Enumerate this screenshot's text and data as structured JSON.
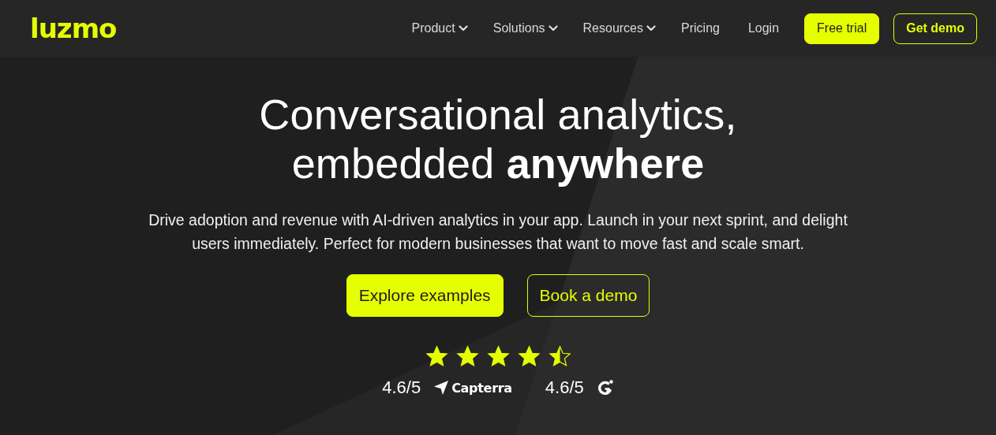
{
  "header": {
    "logo": "luzmo",
    "nav": [
      {
        "label": "Product",
        "dropdown": true
      },
      {
        "label": "Solutions",
        "dropdown": true
      },
      {
        "label": "Resources",
        "dropdown": true
      },
      {
        "label": "Pricing",
        "dropdown": false
      },
      {
        "label": "Login",
        "dropdown": false
      }
    ],
    "buttons": [
      {
        "label": "Free trial",
        "kind": "filled"
      },
      {
        "label": "Get demo",
        "kind": "outline"
      }
    ]
  },
  "hero": {
    "title": "Conversational analytics,\nembedded **anywhere**",
    "subtitle": "Drive adoption and revenue with AI-driven analytics in your app. Launch in your next sprint, and delight users immediately. Perfect for modern businesses that want to move fast and scale smart.",
    "buttons": [
      {
        "label": "Explore examples",
        "kind": "filled"
      },
      {
        "label": "Book a demo",
        "kind": "outline"
      }
    ],
    "stars": 4.5,
    "ratings": [
      {
        "score": "4.6/5",
        "source": "Capterra",
        "kind": "capterra"
      },
      {
        "score": "4.6/5",
        "kind": "g2"
      }
    ]
  }
}
